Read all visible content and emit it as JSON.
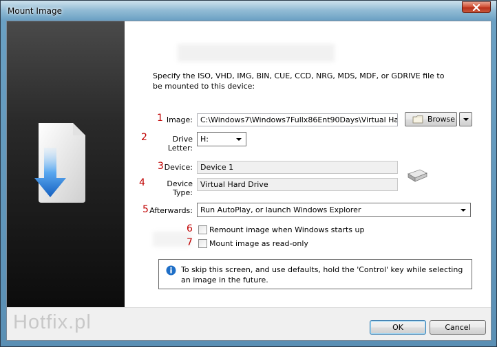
{
  "window": {
    "title": "Mount Image"
  },
  "intro": "Specify the ISO, VHD, IMG, BIN, CUE, CCD, NRG, MDS, MDF, or GDRIVE file to be mounted to this device:",
  "markers": [
    "1",
    "2",
    "3",
    "4",
    "5",
    "6",
    "7"
  ],
  "image": {
    "label": "Image:",
    "value": "C:\\Windows7\\Windows7Fullx86Ent90Days\\Virtual Ha"
  },
  "browse": {
    "label": "Browse"
  },
  "drive_letter": {
    "label": "Drive Letter:",
    "value": "H:"
  },
  "device": {
    "label": "Device:",
    "value": "Device 1"
  },
  "device_type": {
    "label": "Device Type:",
    "value": "Virtual Hard Drive"
  },
  "afterwards": {
    "label": "Afterwards:",
    "value": "Run AutoPlay, or launch Windows Explorer"
  },
  "options": {
    "remount": {
      "label": "Remount image when Windows starts up",
      "checked": false
    },
    "readonly": {
      "label": "Mount image as read-only",
      "checked": false
    }
  },
  "info": "To skip this screen, and use defaults, hold the 'Control' key while selecting an image in the future.",
  "buttons": {
    "ok": "OK",
    "cancel": "Cancel"
  },
  "watermark": "Hotfix.pl",
  "colors": {
    "marker": "#c00000",
    "info_icon": "#1f6fc7",
    "close_button": "#c8442a"
  }
}
